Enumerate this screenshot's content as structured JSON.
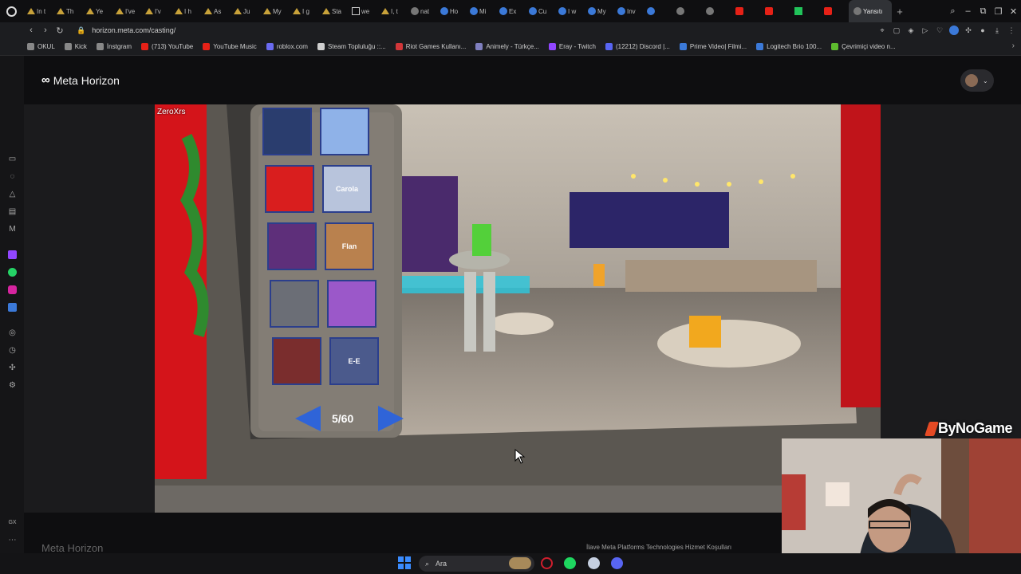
{
  "browser": {
    "tabs": [
      {
        "title": "In t",
        "favicon": "triangle-icon"
      },
      {
        "title": "Th",
        "favicon": "triangle-icon"
      },
      {
        "title": "Ye",
        "favicon": "triangle-icon"
      },
      {
        "title": "I've",
        "favicon": "triangle-icon"
      },
      {
        "title": "I'v",
        "favicon": "triangle-icon"
      },
      {
        "title": "I h",
        "favicon": "triangle-icon"
      },
      {
        "title": "As",
        "favicon": "triangle-icon"
      },
      {
        "title": "Ju",
        "favicon": "triangle-icon"
      },
      {
        "title": "My",
        "favicon": "triangle-icon"
      },
      {
        "title": "I g",
        "favicon": "triangle-icon"
      },
      {
        "title": "Sta",
        "favicon": "triangle-icon"
      },
      {
        "title": "we",
        "favicon": "doc-icon"
      },
      {
        "title": "I, t",
        "favicon": "triangle-icon"
      },
      {
        "title": "nat",
        "favicon": "gray-icon"
      },
      {
        "title": "Ho",
        "favicon": "blue-icon"
      },
      {
        "title": "Mi",
        "favicon": "blue-icon"
      },
      {
        "title": "Ex",
        "favicon": "blue-icon"
      },
      {
        "title": "Cu",
        "favicon": "blue-icon"
      },
      {
        "title": "I w",
        "favicon": "blue-icon"
      },
      {
        "title": "My",
        "favicon": "blue-icon"
      },
      {
        "title": "Inv",
        "favicon": "blue-icon"
      },
      {
        "title": "",
        "favicon": "blue-icon"
      },
      {
        "title": "",
        "favicon": "gray-icon"
      },
      {
        "title": "",
        "favicon": "gray-icon"
      },
      {
        "title": "",
        "favicon": "youtube-icon"
      },
      {
        "title": "",
        "favicon": "youtube-icon"
      },
      {
        "title": "",
        "favicon": "kick-icon"
      },
      {
        "title": "",
        "favicon": "youtube-icon"
      }
    ],
    "active_tab": "Yansıtı",
    "url": "horizon.meta.com/casting/",
    "bookmarks": [
      {
        "label": "OKUL",
        "color": "#888888"
      },
      {
        "label": "Kick",
        "color": "#888888"
      },
      {
        "label": "İnstgram",
        "color": "#888888"
      },
      {
        "label": "(713) YouTube",
        "color": "#e62117"
      },
      {
        "label": "YouTube Music",
        "color": "#e62117"
      },
      {
        "label": "roblox.com",
        "color": "#6a6af0"
      },
      {
        "label": "Steam Topluluğu ::...",
        "color": "#cfcfcf"
      },
      {
        "label": "Riot Games Kullanı...",
        "color": "#d13639"
      },
      {
        "label": "Animely - Türkçe...",
        "color": "#7f7fbf"
      },
      {
        "label": "Eray - Twitch",
        "color": "#9146ff"
      },
      {
        "label": "(12212) Discord |...",
        "color": "#5865f2"
      },
      {
        "label": "Prime Video| Filmi...",
        "color": "#3b79d8"
      },
      {
        "label": "Logitech Brio 100...",
        "color": "#3b79d8"
      },
      {
        "label": "Çevrimiçi video n...",
        "color": "#5dbb2e"
      }
    ]
  },
  "page": {
    "brand": "Meta Horizon",
    "caster_name": "ZeroXrs",
    "footer_brand": "Meta Horizon",
    "footer_legal": "İlave Meta Platforms Technologies Hizmet Koşulları"
  },
  "vr": {
    "grid_page": "5/60",
    "thumbnails": [
      {
        "text": "",
        "color": "#2a3d6e"
      },
      {
        "text": "",
        "color": "#8fb2e8"
      },
      {
        "text": "",
        "color": "#d91e1e"
      },
      {
        "text": "Carola",
        "color": "#b8c4dc"
      },
      {
        "text": "",
        "color": "#5e2f7a"
      },
      {
        "text": "Flan",
        "color": "#b9814e"
      },
      {
        "text": "",
        "color": "#6b6e76"
      },
      {
        "text": "",
        "color": "#9b58c9"
      },
      {
        "text": "",
        "color": "#7a2d2d"
      },
      {
        "text": "E-E",
        "color": "#4b5a8c"
      }
    ]
  },
  "overlay": {
    "watermark": "ByNoGame"
  },
  "taskbar": {
    "search_placeholder": "Ara"
  }
}
